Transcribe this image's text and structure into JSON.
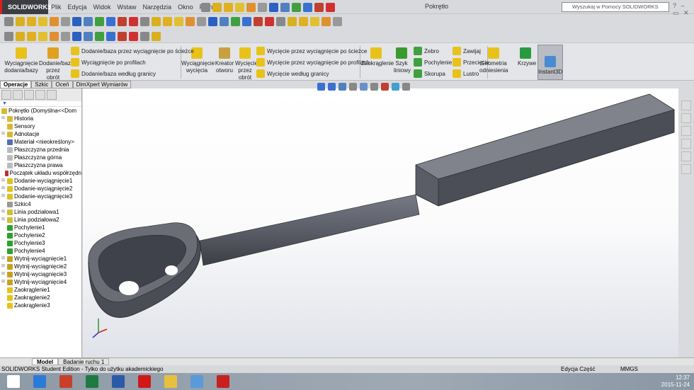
{
  "app": {
    "logo": "SOLIDWORKS",
    "document_title": "Pokrętło",
    "help_search_placeholder": "Wyszukaj w Pomocy SOLIDWORKS"
  },
  "menu": [
    "Plik",
    "Edycja",
    "Widok",
    "Wstaw",
    "Narzędzia",
    "Okno",
    "Pomoc"
  ],
  "command_manager": {
    "big": [
      {
        "label": "Wyciągnięcie dodania/bazy",
        "color": "#e8c21a"
      },
      {
        "label": "Dodanie/baza przez obrót",
        "color": "#e0a020"
      },
      {
        "label": "Wyciągnięcie wycięcia",
        "color": "#e8c21a"
      },
      {
        "label": "Kreator otworu",
        "color": "#c8a040"
      },
      {
        "label": "Wycięcie przez obrót",
        "color": "#e8c21a"
      },
      {
        "label": "Zaokrąglenie",
        "color": "#e8c21a"
      },
      {
        "label": "Szyk liniowy",
        "color": "#3a9a30"
      },
      {
        "label": "Geometria odniesienia",
        "color": "#e8c21a"
      },
      {
        "label": "Krzywe",
        "color": "#2a9a40"
      },
      {
        "label": "Instant3D",
        "color": "#4a8ad0"
      }
    ],
    "small_add": [
      "Dodanie/baza przez wyciągnięcie po ścieżce",
      "Wyciągnięcie po profilach",
      "Dodanie/baza według granicy"
    ],
    "small_cut": [
      "Wycięcie przez wyciągnięcie po ścieżce",
      "Wycięcie przez wyciągnięcie po profilach",
      "Wycięcie według granicy"
    ],
    "small_feat1": [
      "Żebro",
      "Pochylenie",
      "Skorupa"
    ],
    "small_feat2": [
      "Zawijaj",
      "Przecięcie",
      "Lustro"
    ]
  },
  "tabs": [
    "Operacje",
    "Szkic",
    "Oceń",
    "DimXpert Wymiarów"
  ],
  "tree": {
    "root": "Pokrętło  (Domyślna<<Dom",
    "items": [
      {
        "label": "Historia",
        "exp": true,
        "color": "#d8b830"
      },
      {
        "label": "Sensory",
        "exp": false,
        "color": "#d8b830"
      },
      {
        "label": "Adnotacje",
        "exp": true,
        "color": "#d8b830"
      },
      {
        "label": "Materiał <nieokreślony>",
        "exp": false,
        "color": "#5070b0"
      },
      {
        "label": "Płaszczyzna przednia",
        "exp": false,
        "color": "#bbb"
      },
      {
        "label": "Płaszczyzna górna",
        "exp": false,
        "color": "#bbb"
      },
      {
        "label": "Płaszczyzna prawa",
        "exp": false,
        "color": "#bbb"
      },
      {
        "label": "Początek układu współrzędn",
        "exp": false,
        "color": "#c03030"
      },
      {
        "label": "Dodanie-wyciągnięcie1",
        "exp": true,
        "color": "#e0c020"
      },
      {
        "label": "Dodanie-wyciągnięcie2",
        "exp": true,
        "color": "#e0c020"
      },
      {
        "label": "Dodanie-wyciągnięcie3",
        "exp": true,
        "color": "#e0c020"
      },
      {
        "label": "Szkic4",
        "exp": false,
        "color": "#999"
      },
      {
        "label": "Linia podziałowa1",
        "exp": true,
        "color": "#d0c030"
      },
      {
        "label": "Linia podziałowa2",
        "exp": true,
        "color": "#d0c030"
      },
      {
        "label": "Pochylenie1",
        "exp": false,
        "color": "#30a030"
      },
      {
        "label": "Pochylenie2",
        "exp": false,
        "color": "#30a030"
      },
      {
        "label": "Pochylenie3",
        "exp": false,
        "color": "#30a030"
      },
      {
        "label": "Pochylenie4",
        "exp": false,
        "color": "#30a030"
      },
      {
        "label": "Wytnij-wyciągnięcie1",
        "exp": true,
        "color": "#c8a020"
      },
      {
        "label": "Wytnij-wyciągnięcie2",
        "exp": true,
        "color": "#c8a020"
      },
      {
        "label": "Wytnij-wyciągnięcie3",
        "exp": true,
        "color": "#c8a020"
      },
      {
        "label": "Wytnij-wyciągnięcie4",
        "exp": true,
        "color": "#c8a020"
      },
      {
        "label": "Zaokrąglenie1",
        "exp": false,
        "color": "#e8c21a"
      },
      {
        "label": "Zaokrąglenie2",
        "exp": false,
        "color": "#e8c21a"
      },
      {
        "label": "Zaokrąglenie3",
        "exp": false,
        "color": "#e8c21a"
      }
    ]
  },
  "bottom_tabs": [
    "Model",
    "Badanie ruchu 1"
  ],
  "status": {
    "left": "SOLIDWORKS Student Edition - Tylko do użytku akademickiego",
    "mode": "Edycja Część",
    "units": "MMGS"
  },
  "taskbar": {
    "time": "12:37",
    "date": "2015-11-24",
    "apps": [
      {
        "name": "windows-start",
        "color": "#fff"
      },
      {
        "name": "internet-explorer",
        "color": "#2a7ad8"
      },
      {
        "name": "powerpoint",
        "color": "#c8402a"
      },
      {
        "name": "excel",
        "color": "#1e7a40"
      },
      {
        "name": "word",
        "color": "#2a5aa8"
      },
      {
        "name": "opera",
        "color": "#d01818"
      },
      {
        "name": "file-explorer",
        "color": "#e8c040"
      },
      {
        "name": "paint",
        "color": "#5a9ad8"
      },
      {
        "name": "solidworks",
        "color": "#c82020"
      }
    ]
  },
  "colors": {
    "model": "#5a5d66",
    "accent": "#d92020"
  }
}
